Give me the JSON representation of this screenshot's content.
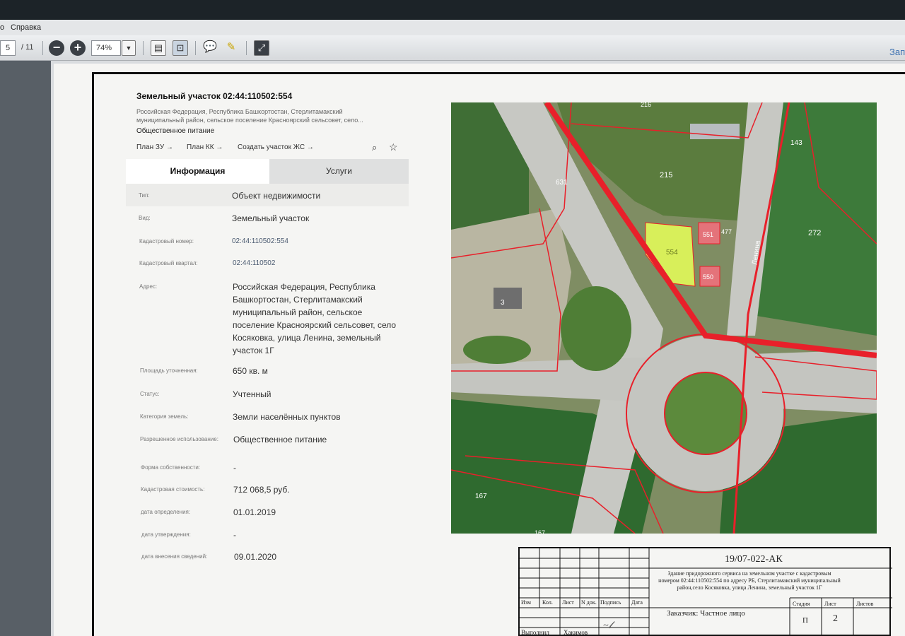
{
  "viewer": {
    "menu": {
      "help": "Справка",
      "partial": "о"
    },
    "toolbar": {
      "page_current": "5",
      "page_total": "/ 11",
      "zoom": "74%",
      "right_partial": "Зап"
    }
  },
  "info": {
    "title": "Земельный участок 02:44:110502:554",
    "address_short": "Российская Федерация, Республика Башкортостан, Стерлитамакский муниципальный район, сельское поселение Красноярский сельсовет, село...",
    "subtitle": "Общественное питание",
    "links": [
      {
        "label": "План ЗУ"
      },
      {
        "label": "План КК"
      },
      {
        "label": "Создать участок ЖС"
      }
    ],
    "tabs": [
      {
        "label": "Информация",
        "active": true
      },
      {
        "label": "Услуги",
        "active": false
      }
    ],
    "rows": [
      {
        "label": "Тип:",
        "value": "Объект недвижимости"
      },
      {
        "label": "Вид:",
        "value": "Земельный участок"
      },
      {
        "label": "Кадастровый номер:",
        "value": "02:44:110502:554"
      },
      {
        "label": "Кадастровый квартал:",
        "value": "02:44:110502"
      },
      {
        "label": "Адрес:",
        "value": "Российская Федерация, Республика Башкортостан, Стерлитамакский муниципальный район, сельское поселение Красноярский сельсовет, село Косяковка, улица Ленина, земельный участок 1Г"
      },
      {
        "label": "Площадь уточненная:",
        "value": "650 кв. м"
      },
      {
        "label": "Статус:",
        "value": "Учтенный"
      },
      {
        "label": "Категория земель:",
        "value": "Земли населённых пунктов"
      },
      {
        "label": "Разрешенное использование:",
        "value": "Общественное питание"
      },
      {
        "label": "Форма собственности:",
        "value": "-"
      },
      {
        "label": "Кадастровая стоимость:",
        "value": "712 068,5 руб."
      },
      {
        "label": "дата определения:",
        "value": "01.01.2019"
      },
      {
        "label": "дата утверждения:",
        "value": "-"
      },
      {
        "label": "дата внесения сведений:",
        "value": "09.01.2020"
      }
    ]
  },
  "map": {
    "parcel_labels": [
      "631",
      "215",
      "272",
      "554",
      "551",
      "550",
      "3",
      "167",
      "143",
      "477",
      "216",
      "167"
    ],
    "street": "Ленина",
    "colors": {
      "boundary": "#e8202a",
      "parcel_fill": "#d8ef5a",
      "forest": "#2f6a2f",
      "road": "#c7c8c3"
    }
  },
  "stamp": {
    "code": "19/07-022-АК",
    "description": "Здание придорожного сервиса на земельном участке с кадастровым номером 02:44:110502:554 по адресу РБ, Стерлитамакский муниципальный район,село Косяковка, улица Ленина, земельный участок 1Г",
    "header_cols": [
      "Изм",
      "Кол.",
      "Лист",
      "N док.",
      "Подпись",
      "Дата"
    ],
    "performer_label": "Выполнил",
    "performer_name": "Хакимов",
    "customer": "Заказчик: Частное лицо",
    "stage_label": "Стадия",
    "sheet_label": "Лист",
    "sheets_label": "Листов",
    "stage_value": "П",
    "sheet_value": "2"
  }
}
